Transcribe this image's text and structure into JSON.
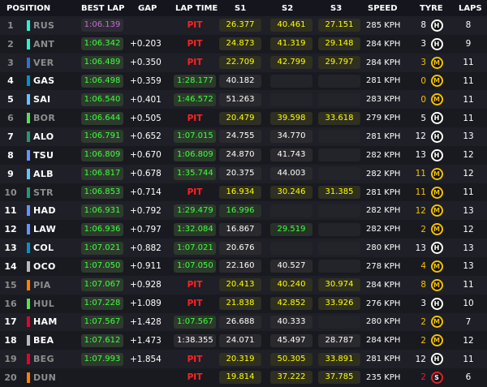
{
  "header": {
    "position": "POSITION",
    "best_lap": "BEST LAP",
    "gap": "GAP",
    "lap_time": "LAP TIME",
    "s1": "S1",
    "s2": "S2",
    "s3": "S3",
    "speed": "SPEED",
    "tyre": "TYRE",
    "laps": "LAPS"
  },
  "colors": {
    "purple": "#c86bd8",
    "green": "#3fff3f",
    "yellow": "#ffff00",
    "pit": "#ff2222"
  },
  "rows": [
    {
      "pos": "1",
      "code": "RUS",
      "team": "#27f4d2",
      "muted": true,
      "best": "1:06.139",
      "best_style": "purple",
      "gap": "",
      "lap": "PIT",
      "lap_style": "pit",
      "s1": "26.377",
      "s1c": "yellow",
      "s2": "40.461",
      "s2c": "yellow",
      "s3": "27.151",
      "s3c": "yellow",
      "speed": "285 KPH",
      "tyre_age": "8",
      "tyre_age_c": "white",
      "tyre": "H",
      "laps": "8"
    },
    {
      "pos": "2",
      "code": "ANT",
      "team": "#27f4d2",
      "muted": true,
      "best": "1:06.342",
      "best_style": "green",
      "gap": "+0.203",
      "lap": "PIT",
      "lap_style": "pit",
      "s1": "24.873",
      "s1c": "yellow",
      "s2": "41.319",
      "s2c": "yellow",
      "s3": "29.148",
      "s3c": "yellow",
      "speed": "284 KPH",
      "tyre_age": "3",
      "tyre_age_c": "white",
      "tyre": "H",
      "laps": "9"
    },
    {
      "pos": "3",
      "code": "VER",
      "team": "#3671c6",
      "muted": true,
      "best": "1:06.489",
      "best_style": "green",
      "gap": "+0.350",
      "lap": "PIT",
      "lap_style": "pit",
      "s1": "22.709",
      "s1c": "yellow",
      "s2": "42.799",
      "s2c": "yellow",
      "s3": "29.797",
      "s3c": "yellow",
      "speed": "284 KPH",
      "tyre_age": "3",
      "tyre_age_c": "yellow",
      "tyre": "M",
      "laps": "11"
    },
    {
      "pos": "4",
      "code": "GAS",
      "team": "#0093cc",
      "muted": false,
      "best": "1:06.498",
      "best_style": "green",
      "gap": "+0.359",
      "lap": "1:28.177",
      "lap_style": "green",
      "s1": "40.182",
      "s1c": "white",
      "s2": "",
      "s2c": "empty",
      "s3": "",
      "s3c": "empty",
      "speed": "281 KPH",
      "tyre_age": "0",
      "tyre_age_c": "yellow",
      "tyre": "M",
      "laps": "11"
    },
    {
      "pos": "5",
      "code": "SAI",
      "team": "#64c4ff",
      "muted": false,
      "best": "1:06.540",
      "best_style": "green",
      "gap": "+0.401",
      "lap": "1:46.572",
      "lap_style": "green",
      "s1": "51.263",
      "s1c": "white",
      "s2": "",
      "s2c": "empty",
      "s3": "",
      "s3c": "empty",
      "speed": "283 KPH",
      "tyre_age": "0",
      "tyre_age_c": "yellow",
      "tyre": "M",
      "laps": "11"
    },
    {
      "pos": "6",
      "code": "BOR",
      "team": "#52e252",
      "muted": true,
      "best": "1:06.644",
      "best_style": "green",
      "gap": "+0.505",
      "lap": "PIT",
      "lap_style": "pit",
      "s1": "20.479",
      "s1c": "yellow",
      "s2": "39.598",
      "s2c": "yellow",
      "s3": "33.618",
      "s3c": "yellow",
      "speed": "279 KPH",
      "tyre_age": "5",
      "tyre_age_c": "white",
      "tyre": "H",
      "laps": "11"
    },
    {
      "pos": "7",
      "code": "ALO",
      "team": "#229971",
      "muted": false,
      "best": "1:06.791",
      "best_style": "green",
      "gap": "+0.652",
      "lap": "1:07.015",
      "lap_style": "green",
      "s1": "24.755",
      "s1c": "white",
      "s2": "34.770",
      "s2c": "white",
      "s3": "",
      "s3c": "empty",
      "speed": "281 KPH",
      "tyre_age": "12",
      "tyre_age_c": "white",
      "tyre": "H",
      "laps": "13"
    },
    {
      "pos": "8",
      "code": "TSU",
      "team": "#6692ff",
      "muted": false,
      "best": "1:06.809",
      "best_style": "green",
      "gap": "+0.670",
      "lap": "1:06.809",
      "lap_style": "green",
      "s1": "24.870",
      "s1c": "white",
      "s2": "41.743",
      "s2c": "white",
      "s3": "",
      "s3c": "empty",
      "speed": "282 KPH",
      "tyre_age": "13",
      "tyre_age_c": "white",
      "tyre": "H",
      "laps": "12"
    },
    {
      "pos": "9",
      "code": "ALB",
      "team": "#64c4ff",
      "muted": false,
      "best": "1:06.817",
      "best_style": "green",
      "gap": "+0.678",
      "lap": "1:35.744",
      "lap_style": "green",
      "s1": "20.375",
      "s1c": "white",
      "s2": "44.003",
      "s2c": "white",
      "s3": "",
      "s3c": "empty",
      "speed": "282 KPH",
      "tyre_age": "11",
      "tyre_age_c": "yellow",
      "tyre": "M",
      "laps": "12"
    },
    {
      "pos": "10",
      "code": "STR",
      "team": "#229971",
      "muted": true,
      "best": "1:06.853",
      "best_style": "green",
      "gap": "+0.714",
      "lap": "PIT",
      "lap_style": "pit",
      "s1": "16.934",
      "s1c": "yellow",
      "s2": "30.246",
      "s2c": "yellow",
      "s3": "31.385",
      "s3c": "yellow",
      "speed": "281 KPH",
      "tyre_age": "11",
      "tyre_age_c": "yellow",
      "tyre": "M",
      "laps": "11"
    },
    {
      "pos": "11",
      "code": "HAD",
      "team": "#6692ff",
      "muted": false,
      "best": "1:06.931",
      "best_style": "green",
      "gap": "+0.792",
      "lap": "1:29.479",
      "lap_style": "green",
      "s1": "16.996",
      "s1c": "green",
      "s2": "",
      "s2c": "empty",
      "s3": "",
      "s3c": "empty",
      "speed": "282 KPH",
      "tyre_age": "12",
      "tyre_age_c": "yellow",
      "tyre": "M",
      "laps": "13"
    },
    {
      "pos": "12",
      "code": "LAW",
      "team": "#6692ff",
      "muted": false,
      "best": "1:06.936",
      "best_style": "green",
      "gap": "+0.797",
      "lap": "1:32.084",
      "lap_style": "green",
      "s1": "16.867",
      "s1c": "white",
      "s2": "29.519",
      "s2c": "green",
      "s3": "",
      "s3c": "empty",
      "speed": "282 KPH",
      "tyre_age": "2",
      "tyre_age_c": "yellow",
      "tyre": "M",
      "laps": "12"
    },
    {
      "pos": "13",
      "code": "COL",
      "team": "#0093cc",
      "muted": false,
      "best": "1:07.021",
      "best_style": "green",
      "gap": "+0.882",
      "lap": "1:07.021",
      "lap_style": "green",
      "s1": "20.676",
      "s1c": "white",
      "s2": "",
      "s2c": "empty",
      "s3": "",
      "s3c": "empty",
      "speed": "280 KPH",
      "tyre_age": "13",
      "tyre_age_c": "white",
      "tyre": "H",
      "laps": "13"
    },
    {
      "pos": "14",
      "code": "OCO",
      "team": "#b6babd",
      "muted": false,
      "best": "1:07.050",
      "best_style": "green",
      "gap": "+0.911",
      "lap": "1:07.050",
      "lap_style": "green",
      "s1": "22.160",
      "s1c": "white",
      "s2": "40.527",
      "s2c": "white",
      "s3": "",
      "s3c": "empty",
      "speed": "278 KPH",
      "tyre_age": "4",
      "tyre_age_c": "yellow",
      "tyre": "M",
      "laps": "13"
    },
    {
      "pos": "15",
      "code": "PIA",
      "team": "#ff8000",
      "muted": true,
      "best": "1:07.067",
      "best_style": "green",
      "gap": "+0.928",
      "lap": "PIT",
      "lap_style": "pit",
      "s1": "20.413",
      "s1c": "yellow",
      "s2": "40.240",
      "s2c": "yellow",
      "s3": "30.974",
      "s3c": "yellow",
      "speed": "284 KPH",
      "tyre_age": "8",
      "tyre_age_c": "yellow",
      "tyre": "M",
      "laps": "11"
    },
    {
      "pos": "16",
      "code": "HUL",
      "team": "#52e252",
      "muted": true,
      "best": "1:07.228",
      "best_style": "green",
      "gap": "+1.089",
      "lap": "PIT",
      "lap_style": "pit",
      "s1": "21.838",
      "s1c": "yellow",
      "s2": "42.852",
      "s2c": "yellow",
      "s3": "33.926",
      "s3c": "yellow",
      "speed": "276 KPH",
      "tyre_age": "3",
      "tyre_age_c": "white",
      "tyre": "H",
      "laps": "10"
    },
    {
      "pos": "17",
      "code": "HAM",
      "team": "#e8002d",
      "muted": false,
      "best": "1:07.567",
      "best_style": "green",
      "gap": "+1.428",
      "lap": "1:07.567",
      "lap_style": "green",
      "s1": "26.688",
      "s1c": "white",
      "s2": "40.333",
      "s2c": "white",
      "s3": "",
      "s3c": "empty",
      "speed": "280 KPH",
      "tyre_age": "2",
      "tyre_age_c": "yellow",
      "tyre": "M",
      "laps": "7"
    },
    {
      "pos": "18",
      "code": "BEA",
      "team": "#b6babd",
      "muted": false,
      "best": "1:07.612",
      "best_style": "green",
      "gap": "+1.473",
      "lap": "1:38.355",
      "lap_style": "white",
      "s1": "24.071",
      "s1c": "white",
      "s2": "45.497",
      "s2c": "white",
      "s3": "28.787",
      "s3c": "white",
      "speed": "284 KPH",
      "tyre_age": "2",
      "tyre_age_c": "yellow",
      "tyre": "M",
      "laps": "12"
    },
    {
      "pos": "19",
      "code": "BEG",
      "team": "#e8002d",
      "muted": true,
      "best": "1:07.993",
      "best_style": "green",
      "gap": "+1.854",
      "lap": "PIT",
      "lap_style": "pit",
      "s1": "20.319",
      "s1c": "yellow",
      "s2": "50.305",
      "s2c": "yellow",
      "s3": "33.891",
      "s3c": "yellow",
      "speed": "281 KPH",
      "tyre_age": "12",
      "tyre_age_c": "white",
      "tyre": "H",
      "laps": "11"
    },
    {
      "pos": "20",
      "code": "DUN",
      "team": "#ff8000",
      "muted": true,
      "best": "",
      "best_style": "none",
      "gap": "",
      "lap": "PIT",
      "lap_style": "pit",
      "s1": "19.814",
      "s1c": "yellow",
      "s2": "37.222",
      "s2c": "yellow",
      "s3": "37.785",
      "s3c": "yellow",
      "speed": "235 KPH",
      "tyre_age": "2",
      "tyre_age_c": "red",
      "tyre": "S",
      "laps": "6"
    }
  ]
}
